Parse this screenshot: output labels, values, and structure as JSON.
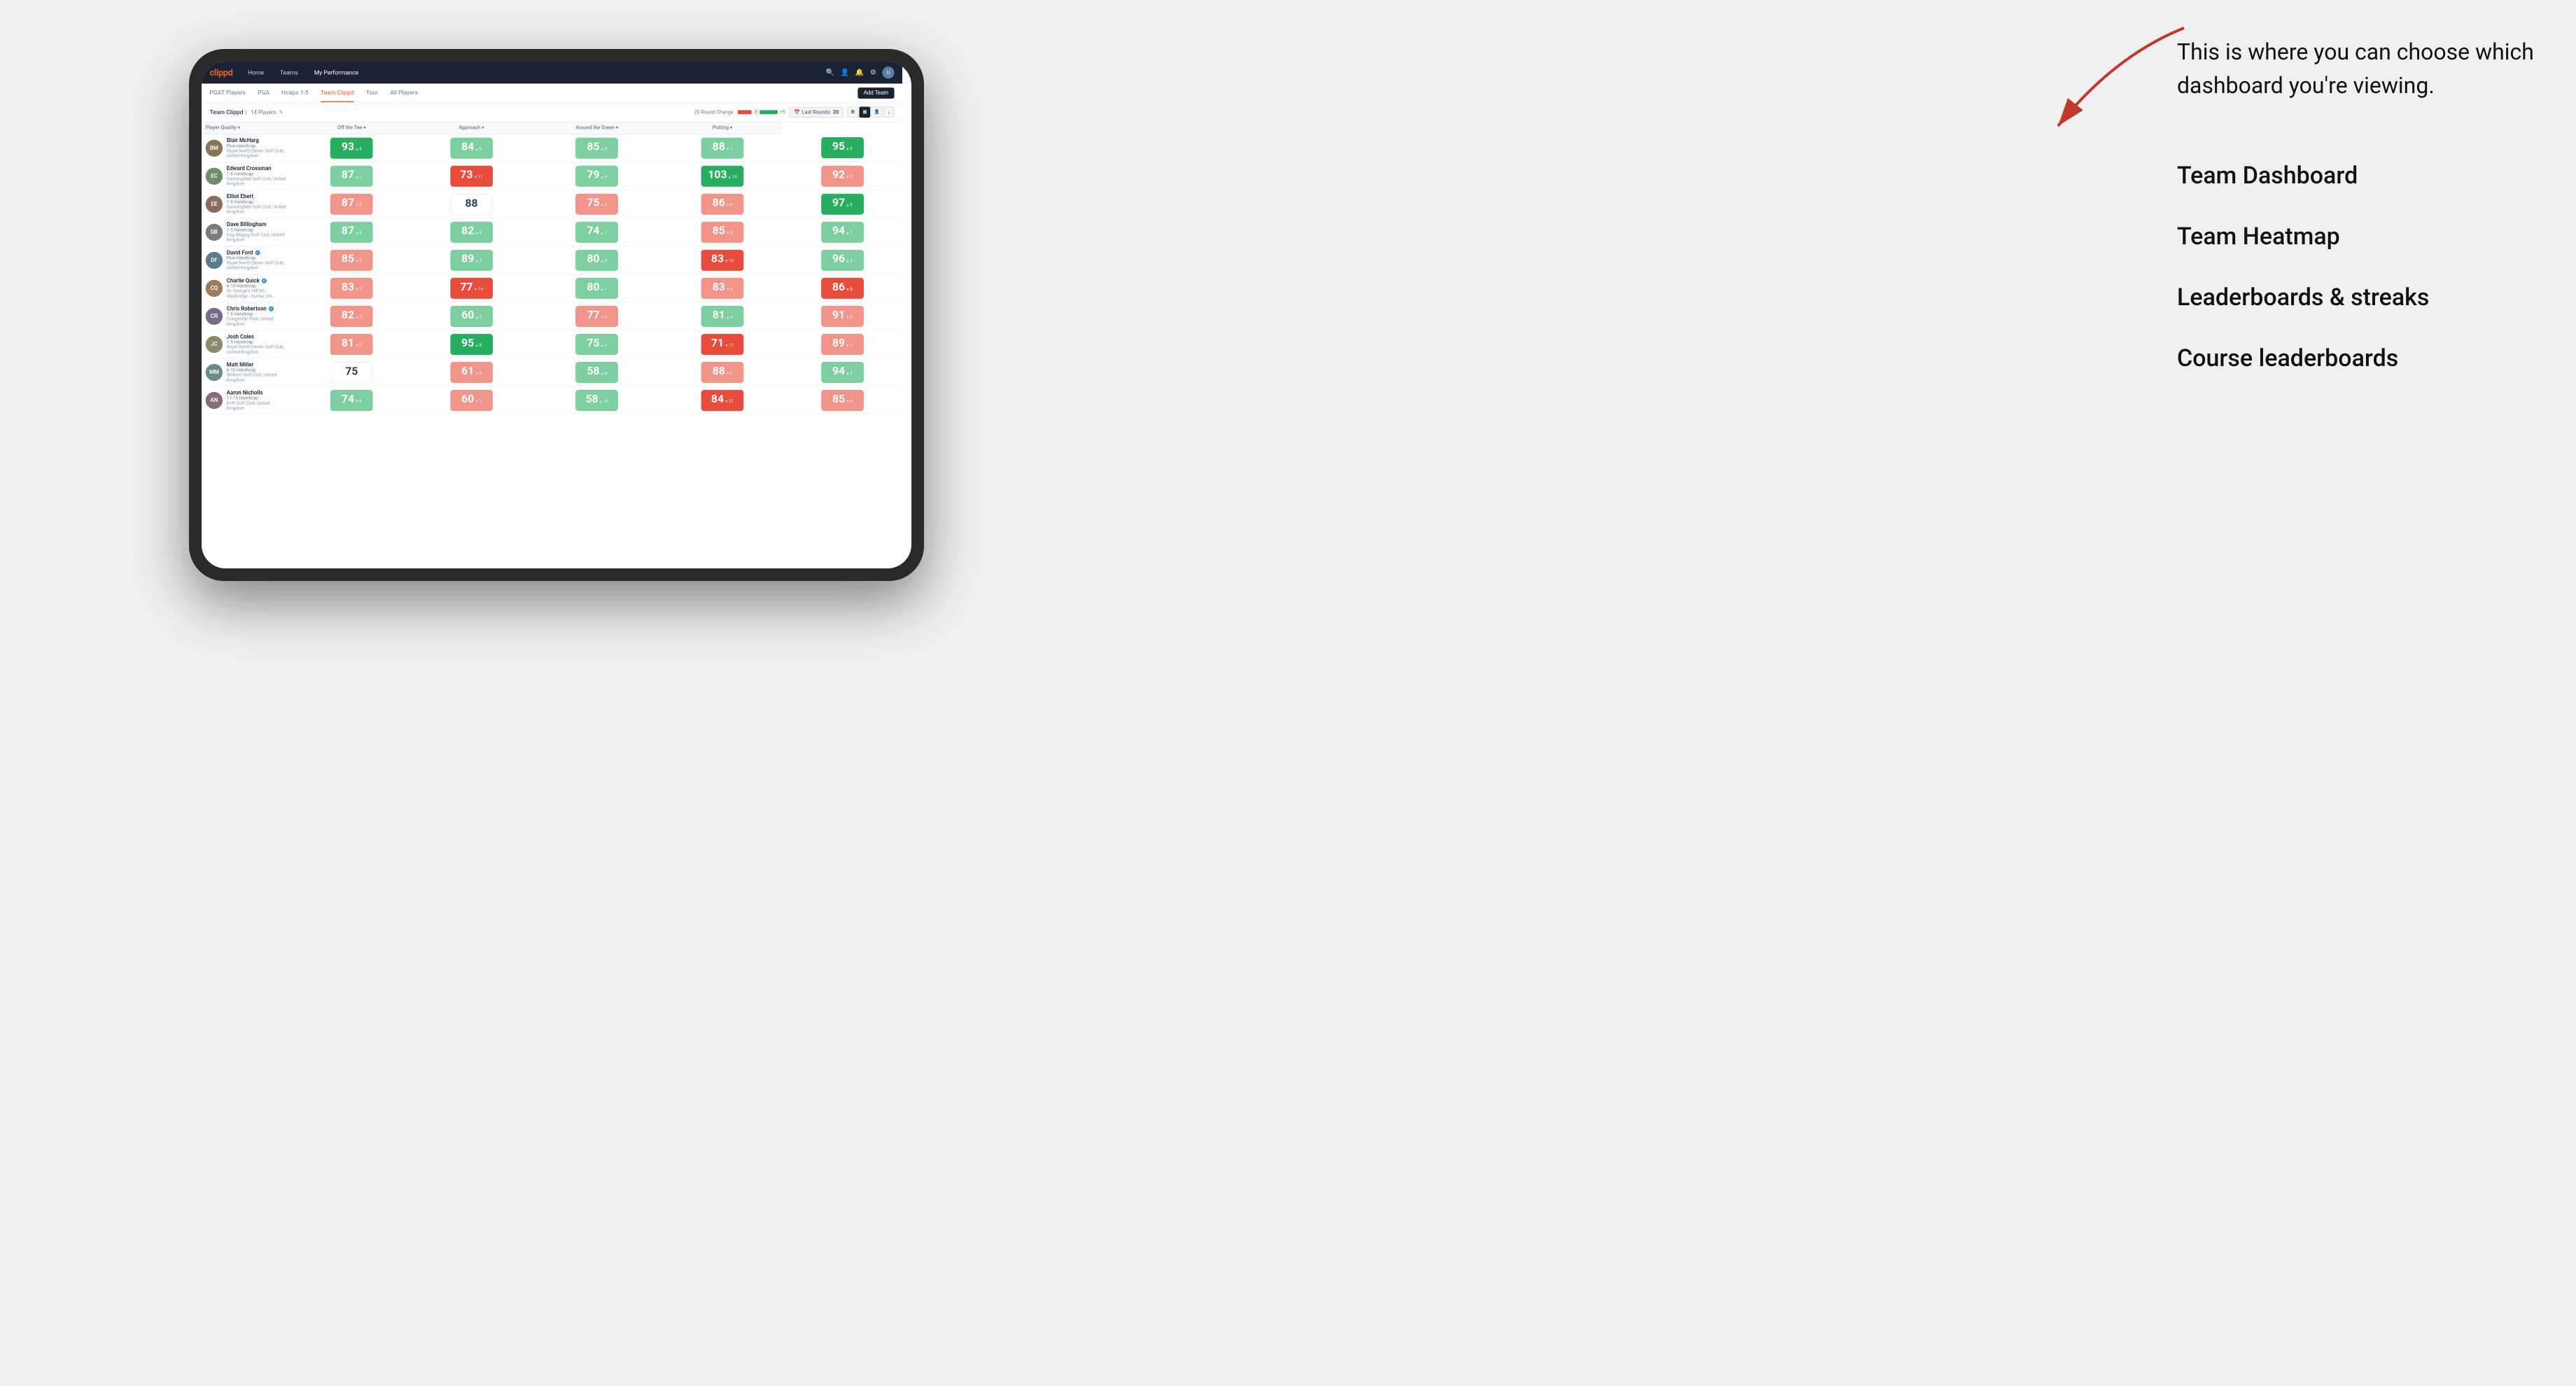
{
  "annotation": {
    "intro_text": "This is where you can choose which dashboard you're viewing.",
    "options": [
      "Team Dashboard",
      "Team Heatmap",
      "Leaderboards & streaks",
      "Course leaderboards"
    ]
  },
  "nav": {
    "logo": "clippd",
    "links": [
      "Home",
      "Teams",
      "My Performance"
    ],
    "active_link": "My Performance"
  },
  "sub_nav": {
    "items": [
      "PGAT Players",
      "PGA",
      "Hcaps 1-5",
      "Team Clippd",
      "Tour",
      "All Players"
    ],
    "active": "Team Clippd",
    "add_button": "Add Team"
  },
  "team_header": {
    "team_name": "Team Clippd",
    "separator": "|",
    "player_count": "14 Players",
    "round_change_label": "20 Round Change",
    "range_neg": "-5",
    "range_pos": "+5",
    "last_rounds_label": "Last Rounds:",
    "last_rounds_value": "20"
  },
  "table": {
    "headers": {
      "player": "Player Quality ▾",
      "off_tee": "Off the Tee ▾",
      "approach": "Approach ▾",
      "around_green": "Around the Green ▾",
      "putting": "Putting ▾"
    },
    "rows": [
      {
        "name": "Blair McHarg",
        "hcap": "Plus Handicap",
        "club": "Royal North Devon Golf Club, United Kingdom",
        "avatar_color": "#8B7355",
        "initials": "BM",
        "player_quality": {
          "value": 93,
          "change": "+4",
          "dir": "up",
          "color": "green-dark"
        },
        "off_tee": {
          "value": 84,
          "change": "+6",
          "dir": "up",
          "color": "green-light"
        },
        "approach": {
          "value": 85,
          "change": "+8",
          "dir": "up",
          "color": "green-light"
        },
        "around_green": {
          "value": 88,
          "change": "-1",
          "dir": "down",
          "color": "green-light"
        },
        "putting": {
          "value": 95,
          "change": "+9",
          "dir": "up",
          "color": "green-dark"
        }
      },
      {
        "name": "Edward Crossman",
        "hcap": "1-5 Handicap",
        "club": "Sunningdale Golf Club, United Kingdom",
        "avatar_color": "#6B8E6B",
        "initials": "EC",
        "player_quality": {
          "value": 87,
          "change": "+1",
          "dir": "up",
          "color": "green-light"
        },
        "off_tee": {
          "value": 73,
          "change": "-11",
          "dir": "down",
          "color": "red-dark"
        },
        "approach": {
          "value": 79,
          "change": "+9",
          "dir": "up",
          "color": "green-light"
        },
        "around_green": {
          "value": 103,
          "change": "+15",
          "dir": "up",
          "color": "green-dark"
        },
        "putting": {
          "value": 92,
          "change": "-3",
          "dir": "down",
          "color": "red-light"
        }
      },
      {
        "name": "Elliot Ebert",
        "hcap": "1-5 Handicap",
        "club": "Sunningdale Golf Club, United Kingdom",
        "avatar_color": "#8B6B5B",
        "initials": "EE",
        "player_quality": {
          "value": 87,
          "change": "-3",
          "dir": "down",
          "color": "red-light"
        },
        "off_tee": {
          "value": 88,
          "change": "",
          "dir": "",
          "color": "white"
        },
        "approach": {
          "value": 75,
          "change": "-3",
          "dir": "down",
          "color": "red-light"
        },
        "around_green": {
          "value": 86,
          "change": "-6",
          "dir": "down",
          "color": "red-light"
        },
        "putting": {
          "value": 97,
          "change": "+5",
          "dir": "up",
          "color": "green-dark"
        }
      },
      {
        "name": "Dave Billingham",
        "hcap": "1-5 Handicap",
        "club": "Gog Magog Golf Club, United Kingdom",
        "avatar_color": "#7B7B7B",
        "initials": "DB",
        "player_quality": {
          "value": 87,
          "change": "+4",
          "dir": "up",
          "color": "green-light"
        },
        "off_tee": {
          "value": 82,
          "change": "+4",
          "dir": "up",
          "color": "green-light"
        },
        "approach": {
          "value": 74,
          "change": "+1",
          "dir": "up",
          "color": "green-light"
        },
        "around_green": {
          "value": 85,
          "change": "-3",
          "dir": "down",
          "color": "red-light"
        },
        "putting": {
          "value": 94,
          "change": "+1",
          "dir": "up",
          "color": "green-light"
        }
      },
      {
        "name": "David Ford",
        "hcap": "Plus Handicap",
        "club": "Royal North Devon Golf Club, United Kingdom",
        "avatar_color": "#5B7A8B",
        "initials": "DF",
        "verified": true,
        "player_quality": {
          "value": 85,
          "change": "-3",
          "dir": "down",
          "color": "red-light"
        },
        "off_tee": {
          "value": 89,
          "change": "+7",
          "dir": "up",
          "color": "green-light"
        },
        "approach": {
          "value": 80,
          "change": "+3",
          "dir": "up",
          "color": "green-light"
        },
        "around_green": {
          "value": 83,
          "change": "-10",
          "dir": "down",
          "color": "red-dark"
        },
        "putting": {
          "value": 96,
          "change": "+3",
          "dir": "up",
          "color": "green-light"
        }
      },
      {
        "name": "Charlie Quick",
        "hcap": "6-10 Handicap",
        "club": "St. George's Hill GC - Weybridge - Surrey, Uni...",
        "avatar_color": "#9B7B5B",
        "initials": "CQ",
        "verified": true,
        "player_quality": {
          "value": 83,
          "change": "-3",
          "dir": "down",
          "color": "red-light"
        },
        "off_tee": {
          "value": 77,
          "change": "-14",
          "dir": "down",
          "color": "red-dark"
        },
        "approach": {
          "value": 80,
          "change": "+1",
          "dir": "up",
          "color": "green-light"
        },
        "around_green": {
          "value": 83,
          "change": "-6",
          "dir": "down",
          "color": "red-light"
        },
        "putting": {
          "value": 86,
          "change": "-8",
          "dir": "down",
          "color": "red-dark"
        }
      },
      {
        "name": "Chris Robertson",
        "hcap": "1-5 Handicap",
        "club": "Craigmillar Park, United Kingdom",
        "avatar_color": "#7B6B8B",
        "initials": "CR",
        "verified": true,
        "player_quality": {
          "value": 82,
          "change": "-3",
          "dir": "down",
          "color": "red-light"
        },
        "off_tee": {
          "value": 60,
          "change": "+2",
          "dir": "up",
          "color": "green-light"
        },
        "approach": {
          "value": 77,
          "change": "-3",
          "dir": "down",
          "color": "red-light"
        },
        "around_green": {
          "value": 81,
          "change": "+4",
          "dir": "up",
          "color": "green-light"
        },
        "putting": {
          "value": 91,
          "change": "-3",
          "dir": "down",
          "color": "red-light"
        }
      },
      {
        "name": "Josh Coles",
        "hcap": "1-5 Handicap",
        "club": "Royal North Devon Golf Club, United Kingdom",
        "avatar_color": "#8B8B6B",
        "initials": "JC",
        "player_quality": {
          "value": 81,
          "change": "-3",
          "dir": "down",
          "color": "red-light"
        },
        "off_tee": {
          "value": 95,
          "change": "+8",
          "dir": "up",
          "color": "green-dark"
        },
        "approach": {
          "value": 75,
          "change": "+2",
          "dir": "up",
          "color": "green-light"
        },
        "around_green": {
          "value": 71,
          "change": "-11",
          "dir": "down",
          "color": "red-dark"
        },
        "putting": {
          "value": 89,
          "change": "-2",
          "dir": "down",
          "color": "red-light"
        }
      },
      {
        "name": "Matt Miller",
        "hcap": "6-10 Handicap",
        "club": "Woburn Golf Club, United Kingdom",
        "avatar_color": "#6B8B8B",
        "initials": "MM",
        "player_quality": {
          "value": 75,
          "change": "",
          "dir": "",
          "color": "white"
        },
        "off_tee": {
          "value": 61,
          "change": "-3",
          "dir": "down",
          "color": "red-light"
        },
        "approach": {
          "value": 58,
          "change": "+4",
          "dir": "up",
          "color": "green-light"
        },
        "around_green": {
          "value": 88,
          "change": "-2",
          "dir": "down",
          "color": "red-light"
        },
        "putting": {
          "value": 94,
          "change": "+3",
          "dir": "up",
          "color": "green-light"
        }
      },
      {
        "name": "Aaron Nicholls",
        "hcap": "11-15 Handicap",
        "club": "Drift Golf Club, United Kingdom",
        "avatar_color": "#8B6B7B",
        "initials": "AN",
        "player_quality": {
          "value": 74,
          "change": "-8",
          "dir": "down",
          "color": "green-light"
        },
        "off_tee": {
          "value": 60,
          "change": "-1",
          "dir": "down",
          "color": "red-light"
        },
        "approach": {
          "value": 58,
          "change": "+10",
          "dir": "up",
          "color": "green-light"
        },
        "around_green": {
          "value": 84,
          "change": "-21",
          "dir": "down",
          "color": "red-dark"
        },
        "putting": {
          "value": 85,
          "change": "-4",
          "dir": "down",
          "color": "red-light"
        }
      }
    ]
  }
}
